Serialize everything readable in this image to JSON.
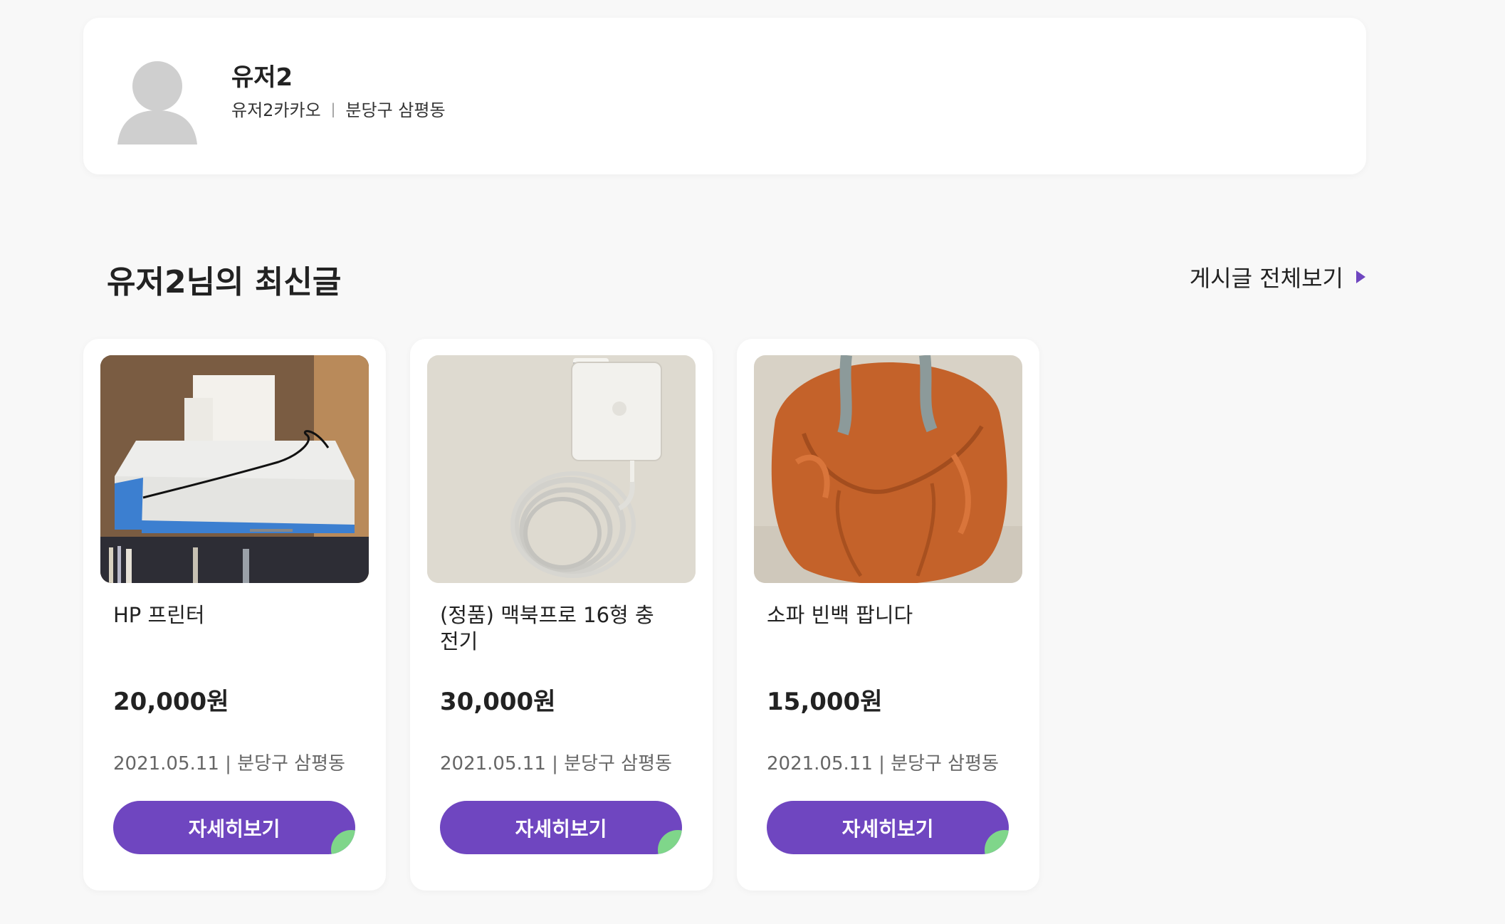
{
  "profile": {
    "name": "유저2",
    "nickname": "유저2카카오",
    "separator": "|",
    "location": "분당구 삼평동"
  },
  "section": {
    "title": "유저2님의 최신글",
    "view_all": "게시글 전체보기"
  },
  "posts": [
    {
      "title": "HP 프린터",
      "price": "20,000원",
      "meta": "2021.05.11 | 분당구 삼평동",
      "button": "자세히보기"
    },
    {
      "title": "(정품) 맥북프로 16형 충전기",
      "price": "30,000원",
      "meta": "2021.05.11 | 분당구 삼평동",
      "button": "자세히보기"
    },
    {
      "title": "소파 빈백 팝니다",
      "price": "15,000원",
      "meta": "2021.05.11 | 분당구 삼평동",
      "button": "자세히보기"
    }
  ],
  "colors": {
    "accent": "#6f46c0",
    "leaf": "#7fd68a",
    "background": "#f8f8f8"
  }
}
